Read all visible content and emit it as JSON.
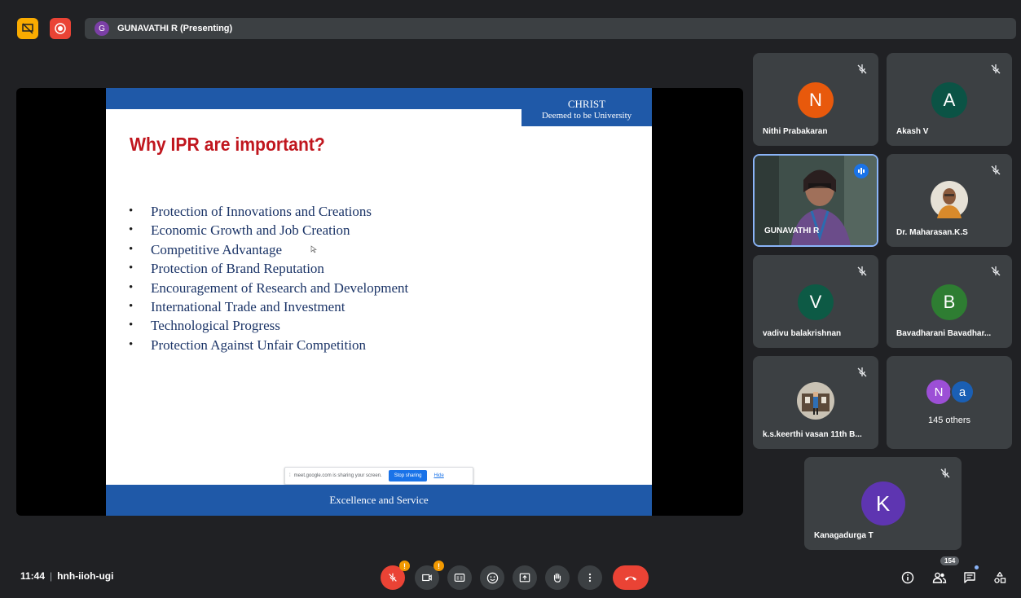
{
  "topbar": {
    "presenter_initial": "G",
    "presenting_text": "GUNAVATHI R (Presenting)"
  },
  "slide": {
    "institution_line1": "CHRIST",
    "institution_line2": "Deemed to be University",
    "title": "Why IPR are important?",
    "bullets": [
      "Protection of Innovations and Creations",
      "Economic Growth and Job Creation",
      "Competitive Advantage",
      "Protection of Brand Reputation",
      "Encouragement of Research and Development",
      "International Trade and Investment",
      "Technological Progress",
      "Protection Against Unfair Competition"
    ],
    "footer": "Excellence and Service",
    "share_notice": "meet.google.com is sharing your screen.",
    "stop_sharing": "Stop sharing",
    "hide": "Hide"
  },
  "participants": [
    {
      "initial": "N",
      "name": "Nithi Prabakaran",
      "color": "#e8590c"
    },
    {
      "initial": "A",
      "name": "Akash V",
      "color": "#0b5345"
    },
    {
      "initial": "",
      "name": "GUNAVATHI R",
      "color": "#3c4043"
    },
    {
      "initial": "",
      "name": "Dr. Maharasan.K.S",
      "color": "#3c4043"
    },
    {
      "initial": "V",
      "name": "vadivu balakrishnan",
      "color": "#0d5a45"
    },
    {
      "initial": "B",
      "name": "Bavadharani Bavadhar...",
      "color": "#2e7d32"
    },
    {
      "initial": "",
      "name": "k.s.keerthi vasan 11th B...",
      "color": "#3c4043"
    },
    {
      "initial": "K",
      "name": "Kanagadurga T",
      "color": "#5e35b1"
    }
  ],
  "others": {
    "initial1": "N",
    "initial2": "a",
    "label": "145 others"
  },
  "bottombar": {
    "time": "11:44",
    "meeting_code": "hnh-iioh-ugi",
    "participant_count": "154",
    "warn_mark": "!"
  }
}
